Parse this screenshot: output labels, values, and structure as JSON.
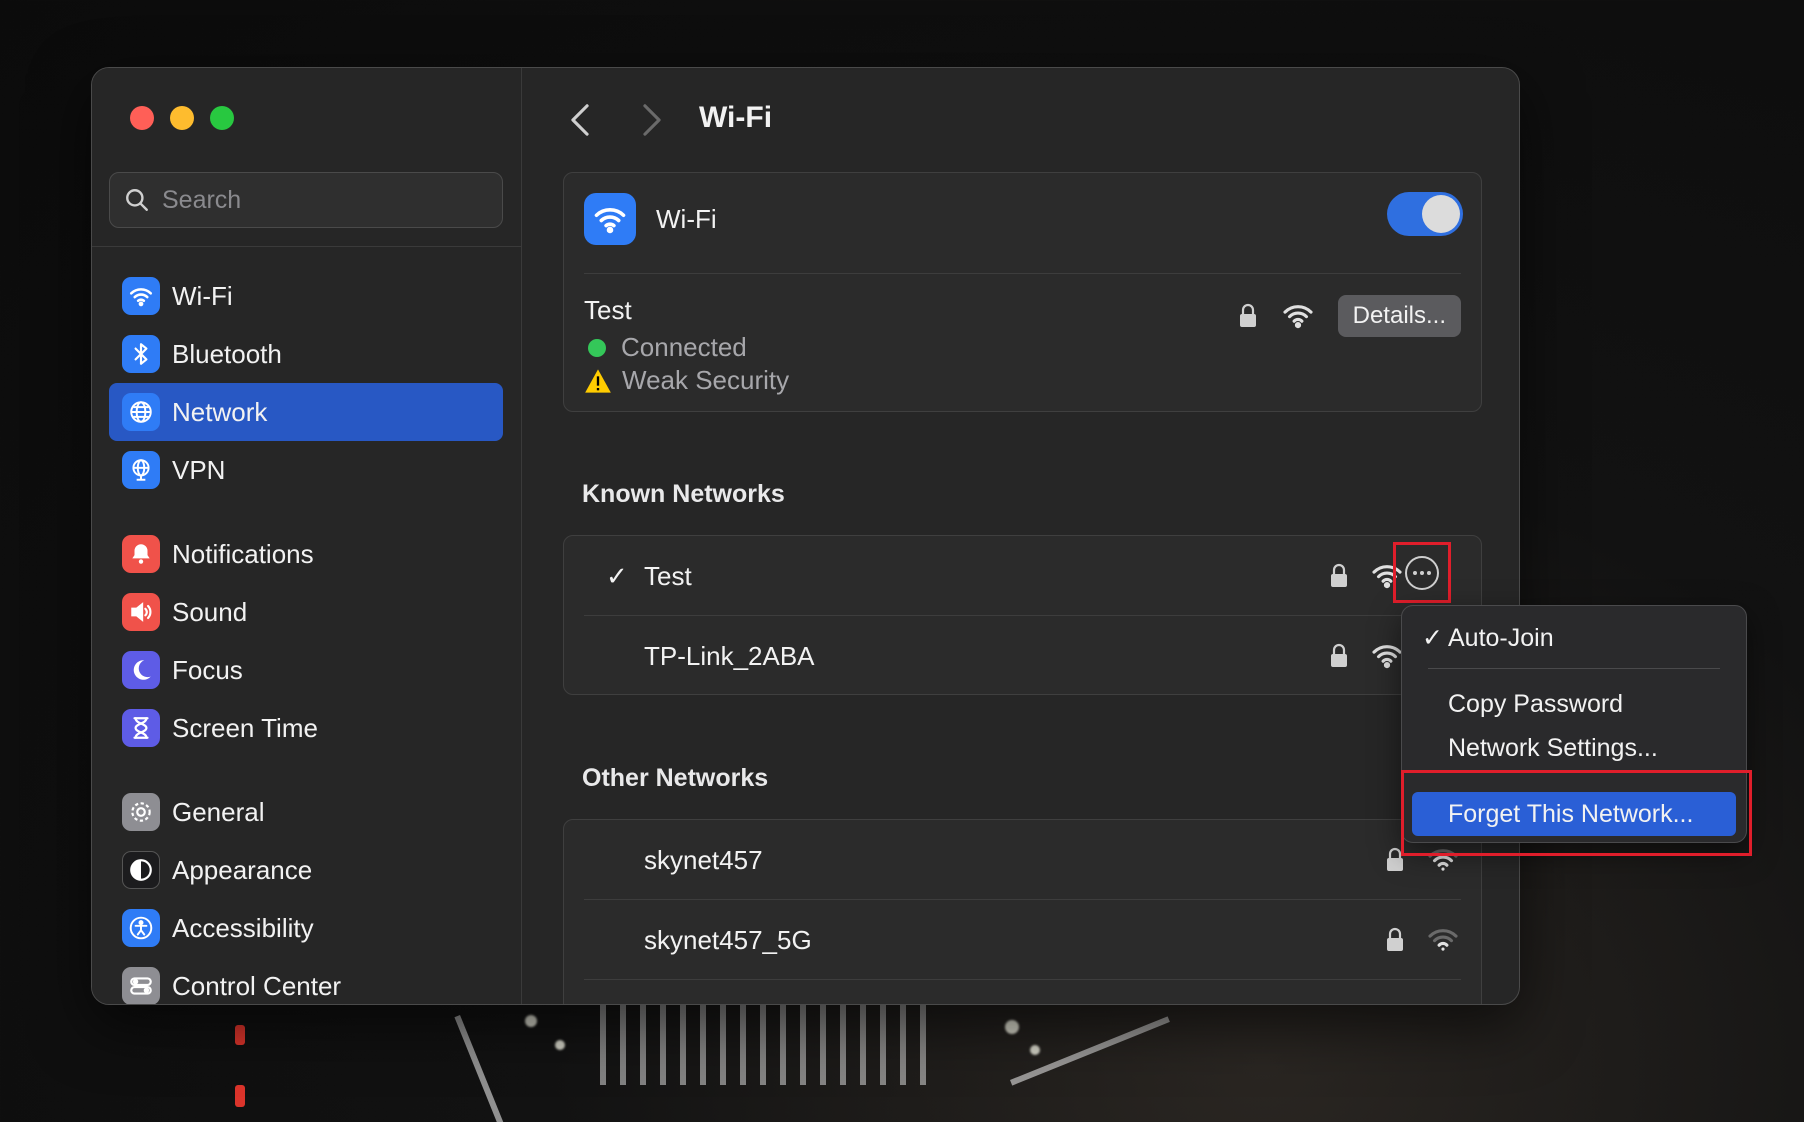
{
  "window": {
    "search_placeholder": "Search",
    "page_title": "Wi-Fi"
  },
  "sidebar": {
    "items": [
      {
        "label": "Wi-Fi",
        "icon": "wifi-icon",
        "color": "#2f7cf6"
      },
      {
        "label": "Bluetooth",
        "icon": "bluetooth-icon",
        "color": "#2f7cf6"
      },
      {
        "label": "Network",
        "icon": "globe-icon",
        "color": "#2f7cf6",
        "active": true
      },
      {
        "label": "VPN",
        "icon": "vpn-globe-icon",
        "color": "#2f7cf6"
      },
      {
        "label": "Notifications",
        "icon": "bell-icon",
        "color": "#f0524a"
      },
      {
        "label": "Sound",
        "icon": "speaker-icon",
        "color": "#f0524a"
      },
      {
        "label": "Focus",
        "icon": "moon-icon",
        "color": "#5e5ce6"
      },
      {
        "label": "Screen Time",
        "icon": "hourglass-icon",
        "color": "#5e5ce6"
      },
      {
        "label": "General",
        "icon": "gear-icon",
        "color": "#8e8e93"
      },
      {
        "label": "Appearance",
        "icon": "appearance-icon",
        "color": "#1c1c1e"
      },
      {
        "label": "Accessibility",
        "icon": "accessibility-icon",
        "color": "#2f7cf6"
      },
      {
        "label": "Control Center",
        "icon": "control-center-icon",
        "color": "#8e8e93"
      }
    ]
  },
  "wifi": {
    "label": "Wi-Fi",
    "enabled": true,
    "current_network": {
      "name": "Test",
      "status": "Connected",
      "security_warning": "Weak Security",
      "details_label": "Details..."
    }
  },
  "known_networks": {
    "title": "Known Networks",
    "items": [
      {
        "name": "Test",
        "connected": true
      },
      {
        "name": "TP-Link_2ABA",
        "connected": false
      }
    ]
  },
  "other_networks": {
    "title": "Other Networks",
    "items": [
      {
        "name": "skynet457"
      },
      {
        "name": "skynet457_5G"
      }
    ]
  },
  "context_menu": {
    "auto_join": "Auto-Join",
    "auto_join_checked": true,
    "copy_password": "Copy Password",
    "network_settings": "Network Settings...",
    "forget_network": "Forget This Network..."
  },
  "colors": {
    "accent": "#2f6fe0",
    "highlight_box": "#e01e2b"
  }
}
